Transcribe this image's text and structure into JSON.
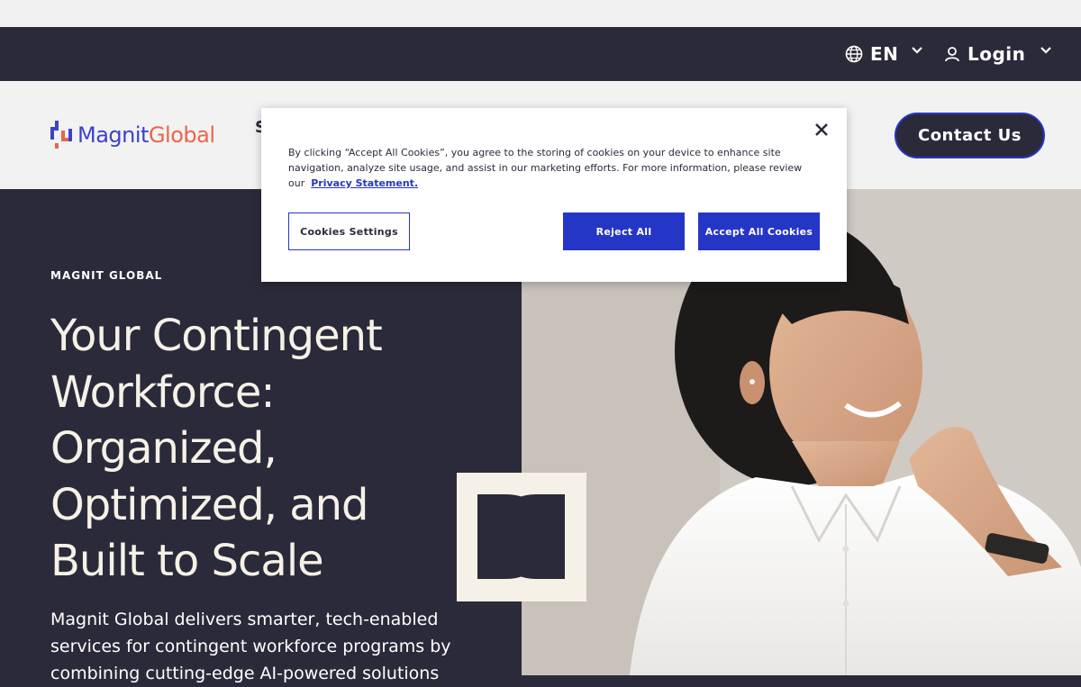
{
  "utility": {
    "language": "EN",
    "login": "Login"
  },
  "header": {
    "logo_magnit": "Magnit",
    "logo_global": "Global",
    "nav_peek": "S",
    "contact_label": "Contact Us"
  },
  "hero": {
    "eyebrow": "MAGNIT GLOBAL",
    "title": "Your Contingent Workforce: Organized, Optimized, and Built to Scale",
    "description": "Magnit Global delivers smarter, tech-enabled services for contingent workforce programs by combining cutting-edge AI-powered solutions"
  },
  "cookies": {
    "text": "By clicking “Accept All Cookies”, you agree to the storing of cookies on your device to enhance site navigation, analyze site usage, and assist in our marketing efforts. For more information, please review our",
    "privacy_link": "Privacy Statement.",
    "settings_label": "Cookies Settings",
    "reject_label": "Reject All",
    "accept_label": "Accept All Cookies"
  },
  "colors": {
    "dark": "#2b2a3a",
    "accent_blue": "#2536c7",
    "logo_blue": "#3b43c7",
    "logo_orange": "#e8674a",
    "cream": "#f6f1e6"
  }
}
